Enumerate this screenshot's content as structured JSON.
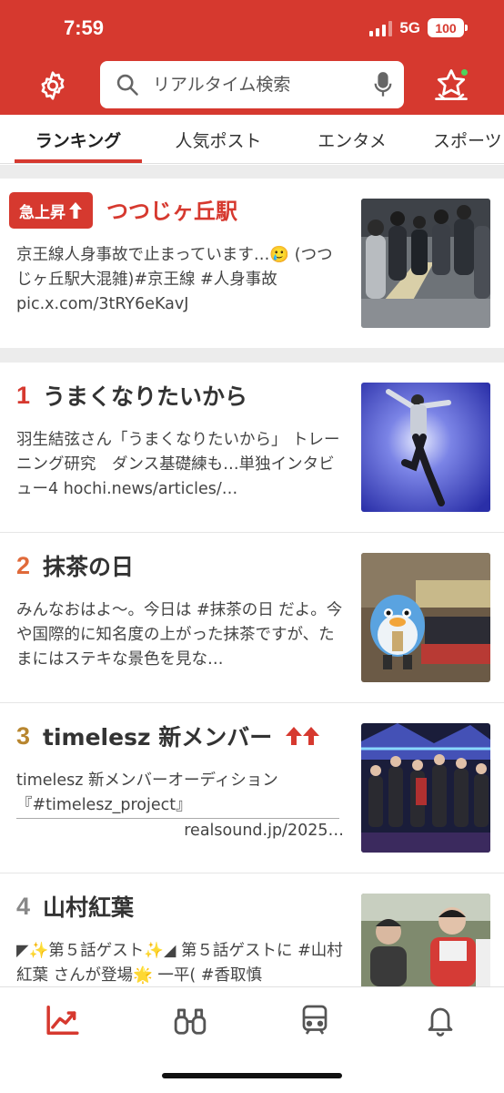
{
  "status_bar": {
    "time": "7:59",
    "network": "5G",
    "battery": "100"
  },
  "header": {
    "search_placeholder": "リアルタイム検索",
    "icons": [
      "gear-icon",
      "search-icon",
      "mic-icon",
      "trending-icon"
    ],
    "accent": "#d6392f"
  },
  "tabs": [
    {
      "label": "ランキング",
      "active": true
    },
    {
      "label": "人気ポスト",
      "active": false
    },
    {
      "label": "エンタメ",
      "active": false
    },
    {
      "label": "スポーツ",
      "active": false
    }
  ],
  "surge": {
    "badge_label": "急上昇",
    "title": "つつじヶ丘駅",
    "desc": "京王線人身事故で止まっています…🥲 (つつじヶ丘駅大混雑)#京王線 #人身事故 pic.x.com/3tRY6eKavJ"
  },
  "rankings": [
    {
      "rank": "1",
      "title": "うまくなりたいから",
      "desc": "羽生結弦さん「うまくなりたいから」 トレーニング研究　ダンス基礎練も…単独インタビュー4 hochi.news/articles/…",
      "rank_color": "#d6392f"
    },
    {
      "rank": "2",
      "title": "抹茶の日",
      "desc": "みんなおはよ〜。今日は #抹茶の日 だよ。今や国際的に知名度の上がった抹茶ですが、たまにはステキな景色を見な…",
      "rank_color": "#e06a3a"
    },
    {
      "rank": "3",
      "title": "timelesz 新メンバー",
      "desc_line1": "timelesz 新メンバーオーディション",
      "desc_line2": "『#timelesz_project』",
      "desc_line3": "realsound.jp/2025…",
      "rank_color": "#b8862f"
    },
    {
      "rank": "4",
      "title": "山村紅葉",
      "desc": "◤✨第５話ゲスト✨◢ 第５話ゲストに #山村紅葉 さんが登場🌟 一平( #香取慎",
      "rank_color": "#888888"
    }
  ],
  "bottom_nav": [
    {
      "name": "ranking-nav-icon",
      "active": true
    },
    {
      "name": "explore-nav-icon",
      "active": false
    },
    {
      "name": "transit-nav-icon",
      "active": false
    },
    {
      "name": "notification-nav-icon",
      "active": false
    }
  ]
}
